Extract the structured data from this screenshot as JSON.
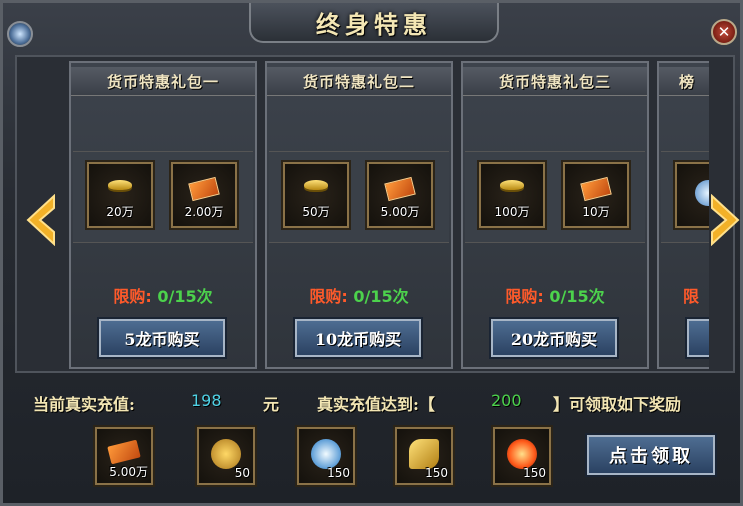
{
  "window": {
    "title": "终身特惠",
    "close_glyph": "✕",
    "corner_icon": "orb-icon"
  },
  "packages": [
    {
      "title": "货币特惠礼包一",
      "items": [
        {
          "icon": "gold-ingot-icon",
          "amount": "20万"
        },
        {
          "icon": "coupon-icon",
          "amount": "2.00万"
        }
      ],
      "limit_label": "限购:",
      "limit_value": "0/15次",
      "buy_label": "5龙币购买"
    },
    {
      "title": "货币特惠礼包二",
      "items": [
        {
          "icon": "gold-ingot-icon",
          "amount": "50万"
        },
        {
          "icon": "coupon-icon",
          "amount": "5.00万"
        }
      ],
      "limit_label": "限购:",
      "limit_value": "0/15次",
      "buy_label": "10龙币购买"
    },
    {
      "title": "货币特惠礼包三",
      "items": [
        {
          "icon": "gold-ingot-icon",
          "amount": "100万"
        },
        {
          "icon": "coupon-icon",
          "amount": "10万"
        }
      ],
      "limit_label": "限购:",
      "limit_value": "0/15次",
      "buy_label": "20龙币购买"
    },
    {
      "title": "榜",
      "items": [
        {
          "icon": "crystal-icon",
          "amount": ""
        }
      ],
      "limit_label": "限",
      "limit_value": "",
      "buy_label": ""
    }
  ],
  "nav": {
    "prev_icon": "left-arrow-icon",
    "next_icon": "right-arrow-icon"
  },
  "recharge": {
    "current_label": "当前真实充值:",
    "current_value": "198",
    "unit": "元",
    "target_label": "真实充值达到:【",
    "target_value": "200",
    "target_suffix": "】可领取如下奖励"
  },
  "rewards": [
    {
      "icon": "coupon-icon",
      "amount": "5.00万"
    },
    {
      "icon": "gold-coin-icon",
      "amount": "50"
    },
    {
      "icon": "crystal-orb-icon",
      "amount": "150"
    },
    {
      "icon": "golden-horn-icon",
      "amount": "150"
    },
    {
      "icon": "fire-orb-icon",
      "amount": "150"
    }
  ],
  "claim_label": "点击领取",
  "colors": {
    "limit_red": "#ff5a2a",
    "limit_green": "#4cd24c",
    "recharge_cyan": "#4fd2e6",
    "gold_text": "#f3e6b4"
  }
}
